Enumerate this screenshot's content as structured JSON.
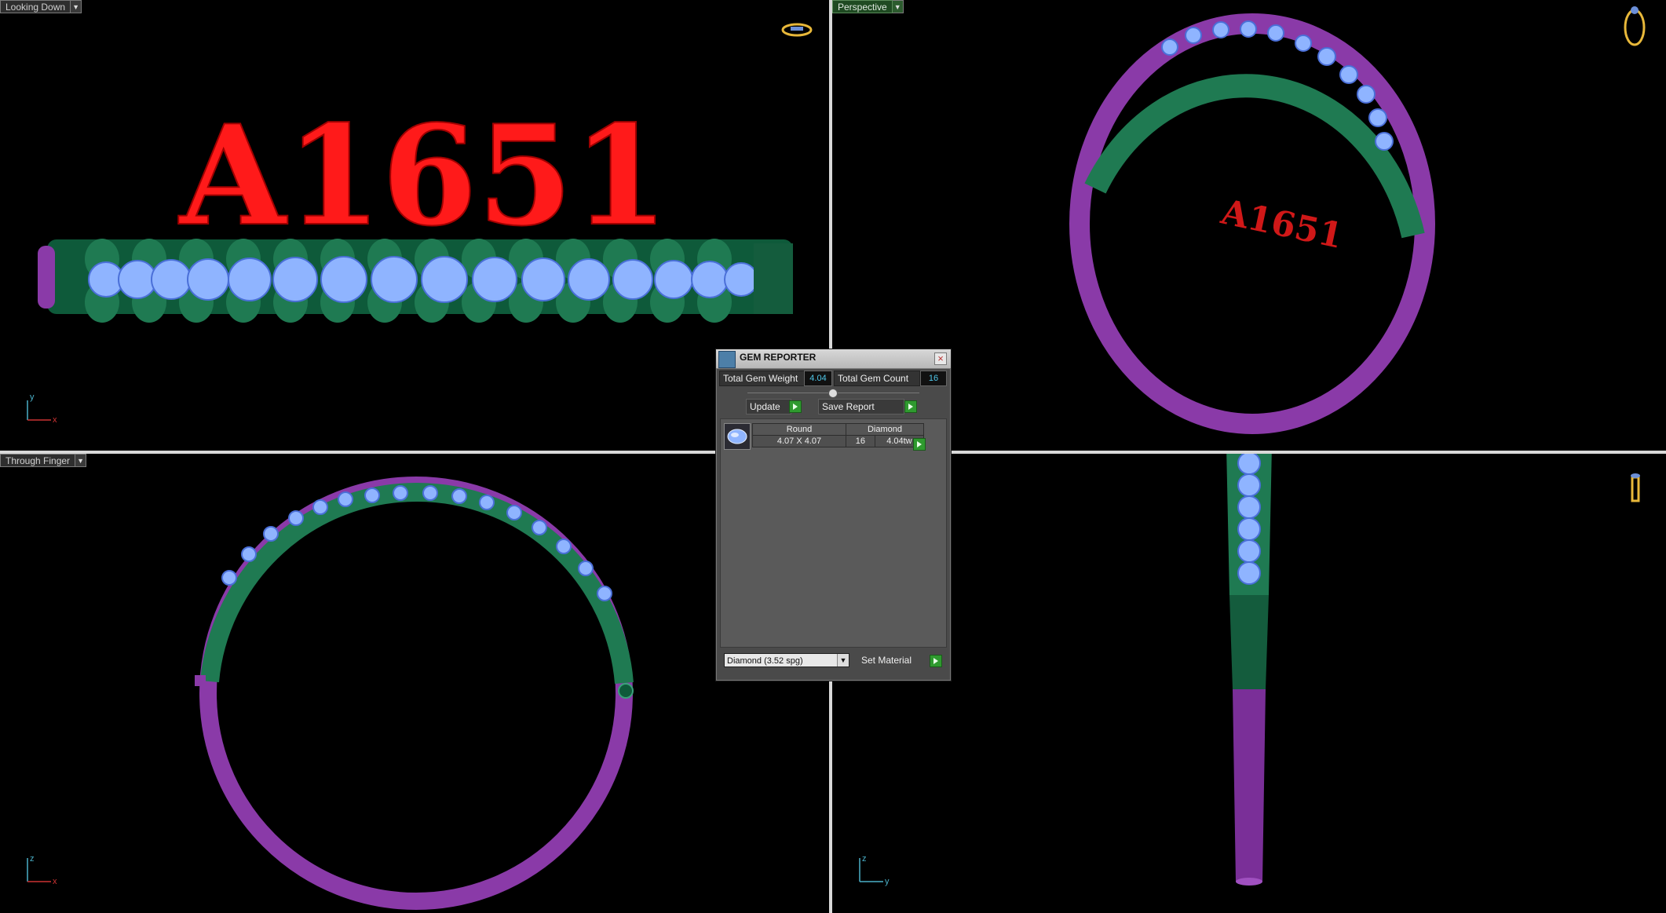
{
  "viewports": {
    "top_left": {
      "label": "Looking Down",
      "axis_v": "y",
      "axis_h": "x"
    },
    "top_right": {
      "label": "Perspective"
    },
    "bottom_left": {
      "label": "Through Finger",
      "axis_v": "z",
      "axis_h": "x"
    },
    "bottom_right": {
      "axis_v": "z",
      "axis_h": "y"
    }
  },
  "model_text": "A1651",
  "gem_reporter": {
    "title": "GEM REPORTER",
    "total_weight_label": "Total Gem Weight",
    "total_weight_value": "4.04",
    "total_count_label": "Total Gem Count",
    "total_count_value": "16",
    "update_label": "Update",
    "save_report_label": "Save Report",
    "row": {
      "shape": "Round",
      "material": "Diamond",
      "size": "4.07 X 4.07",
      "count": "16",
      "weight": "4.04tw"
    },
    "material_select": "Diamond     (3.52 spg)",
    "set_material_label": "Set Material"
  },
  "colors": {
    "metal_green": "#1f7a52",
    "metal_purple": "#8a3aa8",
    "gem_blue": "#8fb4ff",
    "text_red": "#ff1a1a",
    "accent_green": "#2f9a2f"
  }
}
